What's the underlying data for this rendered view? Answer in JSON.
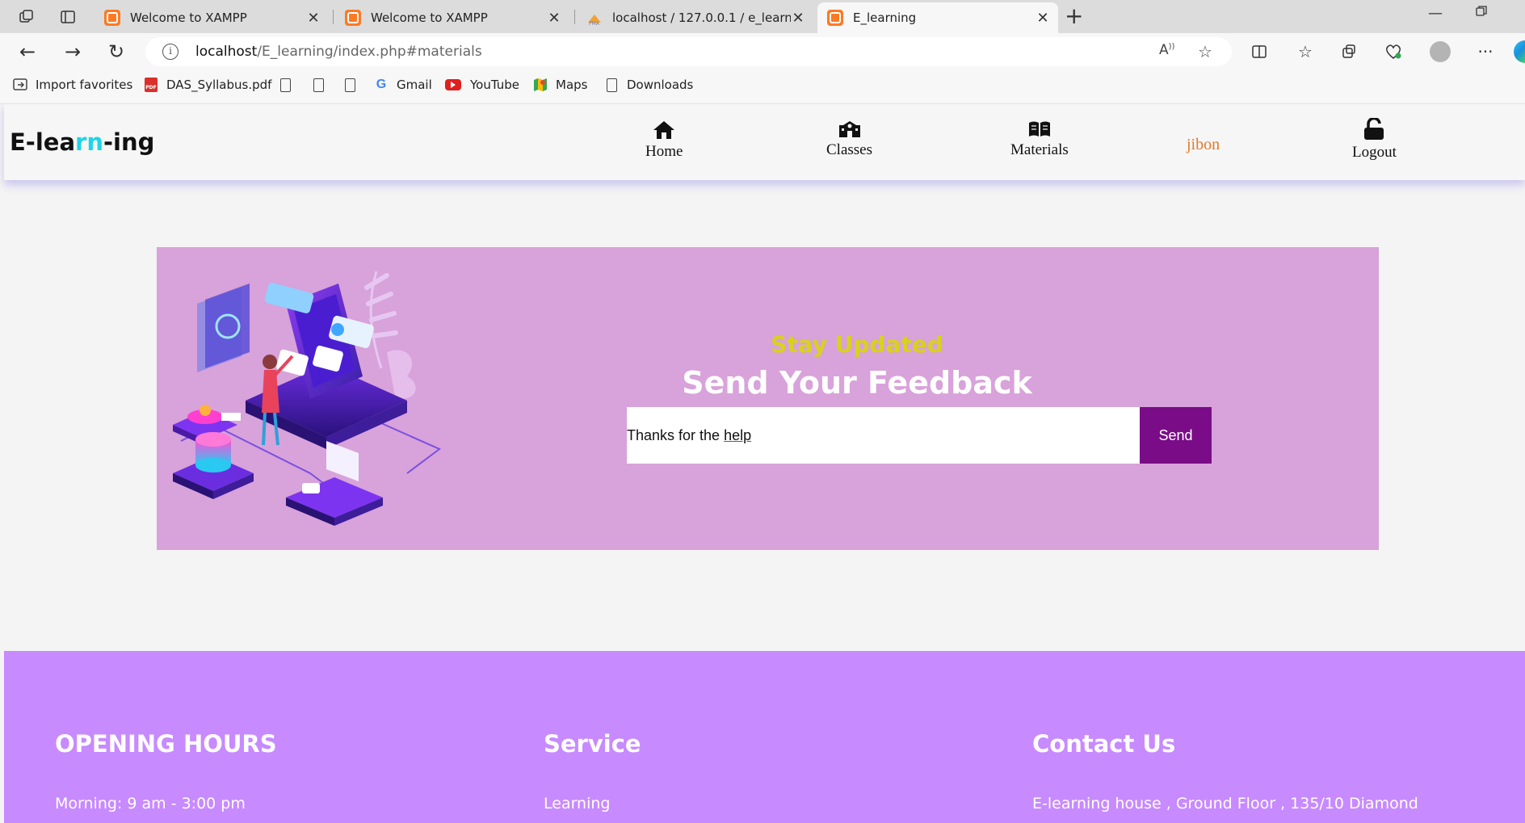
{
  "browser": {
    "tabs": [
      {
        "title": "Welcome to XAMPP",
        "active": false
      },
      {
        "title": "Welcome to XAMPP",
        "active": false
      },
      {
        "title": "localhost / 127.0.0.1 / e_learning",
        "active": false
      },
      {
        "title": "E_learning",
        "active": true
      }
    ],
    "url_host": "localhost",
    "url_path": "/E_learning/index.php#materials",
    "bookmarks": [
      "Import favorites",
      "DAS_Syllabus.pdf",
      "Gmail",
      "YouTube",
      "Maps",
      "Downloads"
    ]
  },
  "site": {
    "brand_pre": "E-lea",
    "brand_hl": "rn",
    "brand_post": "-ing",
    "nav": {
      "home": "Home",
      "classes": "Classes",
      "materials": "Materials",
      "user": "jibon",
      "logout": "Logout"
    }
  },
  "feedback": {
    "kicker": "Stay Updated",
    "title": "Send Your Feedback",
    "input_text_pre": "Thanks for the ",
    "input_text_underlined": "help",
    "send_label": "Send"
  },
  "footer": {
    "hours_title": "OPENING HOURS",
    "hours_line": "Morning: 9 am - 3:00 pm",
    "service_title": "Service",
    "service_line": "Learning",
    "contact_title": "Contact Us",
    "contact_line": "E-learning house , Ground Floor , 135/10 Diamond"
  },
  "colors": {
    "feedback_bg": "#d8a2da",
    "send_button": "#7a0d87",
    "kicker": "#d8d21c",
    "footer_bg": "#c78aff",
    "user_link": "#e07a2b",
    "brand_highlight": "#1fd4e6"
  }
}
